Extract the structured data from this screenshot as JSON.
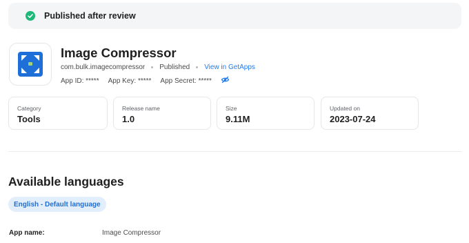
{
  "banner": {
    "status_text": "Published after review",
    "status_color": "#1db87a"
  },
  "app": {
    "name": "Image Compressor",
    "package": "com.bulk.imagecompressor",
    "status": "Published",
    "store_link": "View in GetApps",
    "app_id": "App ID: *****",
    "app_key": "App Key: *****",
    "app_secret": "App Secret: *****",
    "icon": "image-compressor-app-icon",
    "icon_color": "#1e6fd8",
    "accent_color": "#1f7cf2"
  },
  "stats": [
    {
      "label": "Category",
      "value": "Tools"
    },
    {
      "label": "Release name",
      "value": "1.0"
    },
    {
      "label": "Size",
      "value": "9.11M"
    },
    {
      "label": "Updated on",
      "value": "2023-07-24"
    }
  ],
  "languages": {
    "title": "Available languages",
    "chips": [
      "English - Default language"
    ]
  },
  "fields": [
    {
      "label": "App name:",
      "value": "Image Compressor"
    }
  ]
}
